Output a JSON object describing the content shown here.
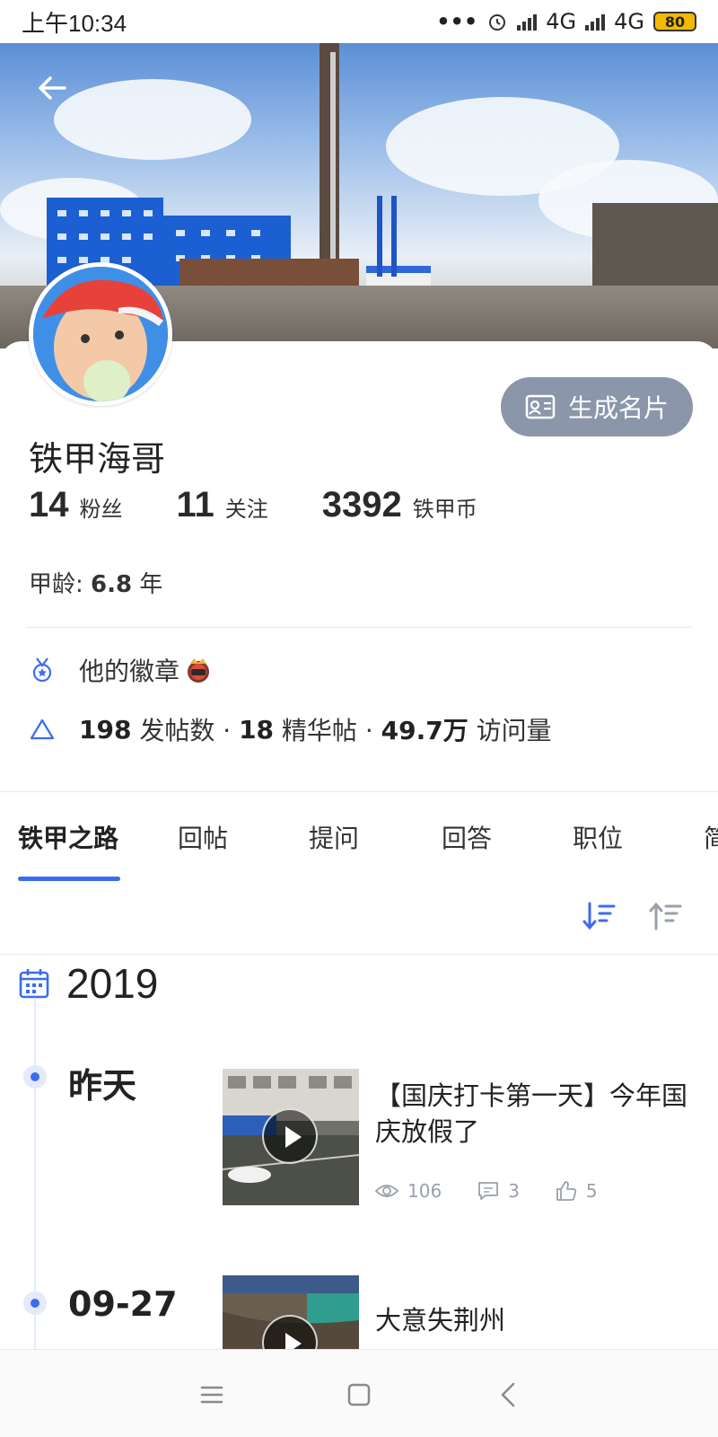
{
  "status_bar": {
    "time": "上午10:34",
    "dots": "•••",
    "network_1": "4G",
    "network_2": "4G",
    "battery": "80"
  },
  "header": {
    "back_icon": "arrow-left-icon"
  },
  "profile": {
    "card_button_label": "生成名片",
    "name": "铁甲海哥",
    "stats": [
      {
        "value": "14",
        "label": "粉丝"
      },
      {
        "value": "11",
        "label": "关注"
      },
      {
        "value": "3392",
        "label": "铁甲币"
      }
    ],
    "age_label": "甲龄: ",
    "age_value": "6.8",
    "age_unit": " 年",
    "badges_label": "他的徽章",
    "post_count": "198",
    "post_count_label": " 发帖数 · ",
    "featured_count": "18",
    "featured_label": " 精华帖 · ",
    "visits": "49.7万",
    "visits_label": " 访问量"
  },
  "tabs": [
    {
      "label": "铁甲之路",
      "active": true
    },
    {
      "label": "回帖"
    },
    {
      "label": "提问"
    },
    {
      "label": "回答"
    },
    {
      "label": "职位"
    },
    {
      "label": "简"
    }
  ],
  "timeline": {
    "year": "2019",
    "posts": [
      {
        "date": "昨天",
        "title": "【国庆打卡第一天】今年国庆放假了",
        "views": "106",
        "comments": "3",
        "likes": "5"
      },
      {
        "date": "09-27",
        "title": "大意失荆州"
      }
    ]
  },
  "colors": {
    "accent": "#3b6cf0",
    "button_gray": "#8b96ab",
    "battery": "#f5b800"
  }
}
